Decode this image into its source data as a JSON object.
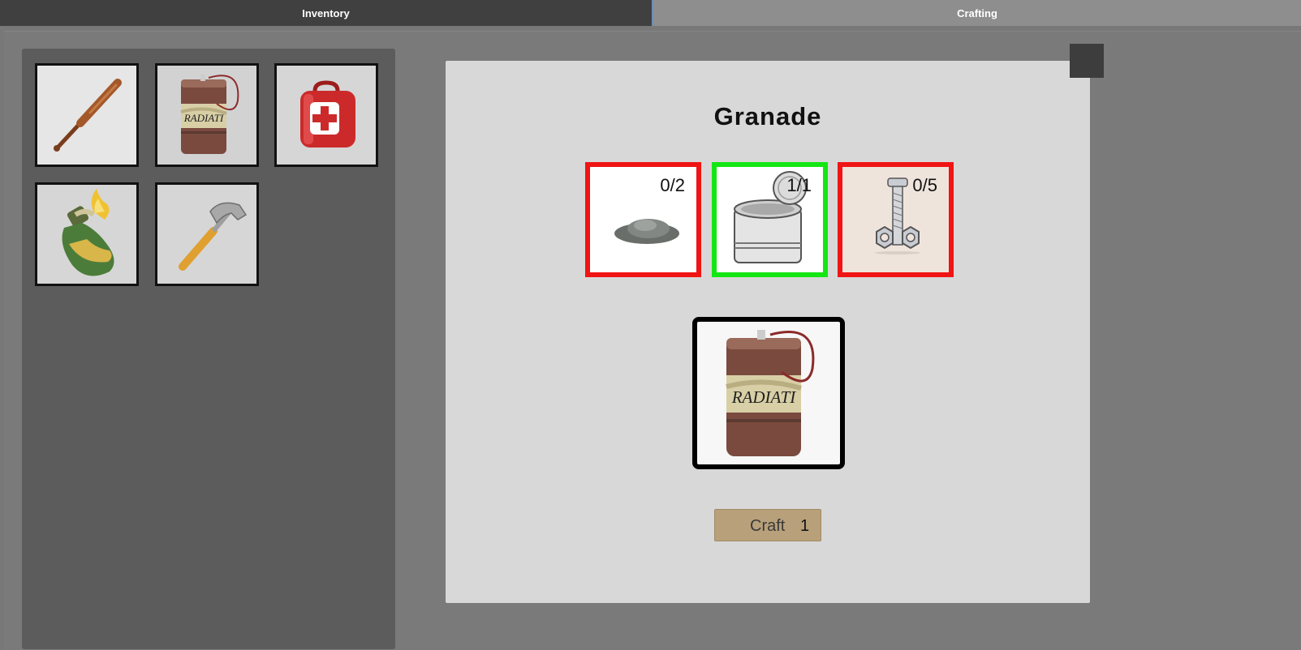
{
  "tabs": {
    "inventory": "Inventory",
    "crafting": "Crafting"
  },
  "inventory": {
    "items": [
      {
        "icon": "baseball-bat-icon"
      },
      {
        "icon": "radiation-barrel-grenade-icon"
      },
      {
        "icon": "first-aid-kit-icon"
      },
      {
        "icon": "molotov-cocktail-icon"
      },
      {
        "icon": "hammer-icon"
      }
    ]
  },
  "crafting": {
    "title": "Granade",
    "ingredients": [
      {
        "icon": "gunpowder-icon",
        "count": "0/2",
        "status": "missing"
      },
      {
        "icon": "tin-can-icon",
        "count": "1/1",
        "status": "ok"
      },
      {
        "icon": "bolt-and-nuts-icon",
        "count": "0/5",
        "status": "missing"
      }
    ],
    "result_icon": "radiation-barrel-grenade-icon",
    "craft_label": "Craft",
    "craft_quantity": "1"
  },
  "colors": {
    "missing": "#f01414",
    "ok": "#14e614",
    "craft_button": "#b8a07a"
  }
}
